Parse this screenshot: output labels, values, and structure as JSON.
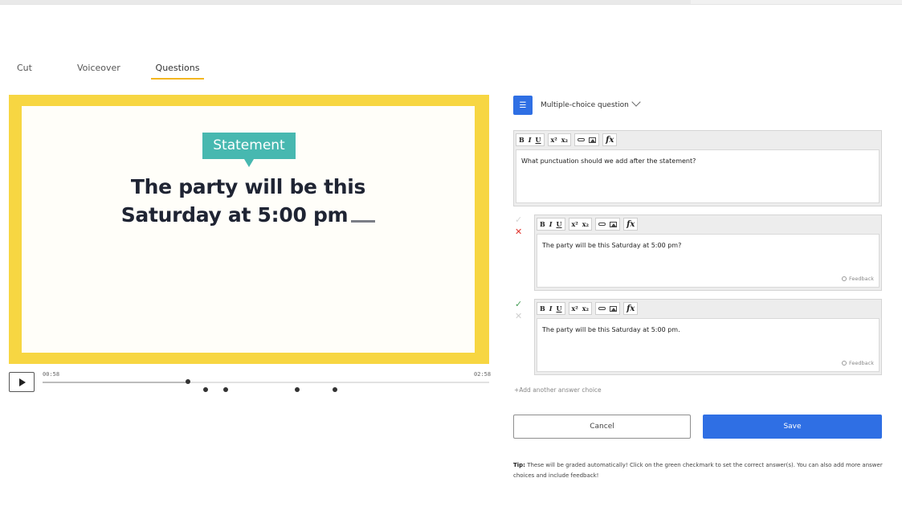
{
  "tabs": [
    {
      "label": "Cut",
      "active": false
    },
    {
      "label": "Voiceover",
      "active": false
    },
    {
      "label": "Questions",
      "active": true
    }
  ],
  "video": {
    "badge_text": "Statement",
    "slide_line1": "The party will be this",
    "slide_line2": "Saturday at 5:00 pm",
    "current_time": "00:58",
    "total_time": "02:58",
    "progress_fraction": 0.325,
    "marker_fractions": [
      0.365,
      0.41,
      0.57,
      0.655
    ]
  },
  "question": {
    "type_label": "Multiple-choice question",
    "type_icon": "list-icon",
    "prompt_text": "What punctuation should we add after the statement?"
  },
  "toolbar": {
    "bold": "B",
    "italic": "I",
    "underline": "U",
    "superscript": "x²",
    "subscript": "x₂",
    "formula": "fx"
  },
  "answers": [
    {
      "text": "The party will be this Saturday at 5:00 pm?",
      "correct": false,
      "feedback_label": "Feedback"
    },
    {
      "text": "The party will be this Saturday at 5:00 pm.",
      "correct": true,
      "feedback_label": "Feedback"
    }
  ],
  "marks": {
    "check": "✓",
    "cross": "✕"
  },
  "add_choice_label": "+Add another answer choice",
  "buttons": {
    "cancel": "Cancel",
    "save": "Save"
  },
  "tip": {
    "label": "Tip:",
    "text": " These will be graded automatically! Click on the green checkmark to set the correct answer(s). You can also add more answer choices and include feedback!"
  },
  "colors": {
    "accent": "#2f6fe4",
    "tab_underline": "#f3b61f",
    "video_border": "#f7d642",
    "badge": "#47b8b0",
    "correct": "#4aa05a",
    "incorrect": "#e0332c"
  }
}
